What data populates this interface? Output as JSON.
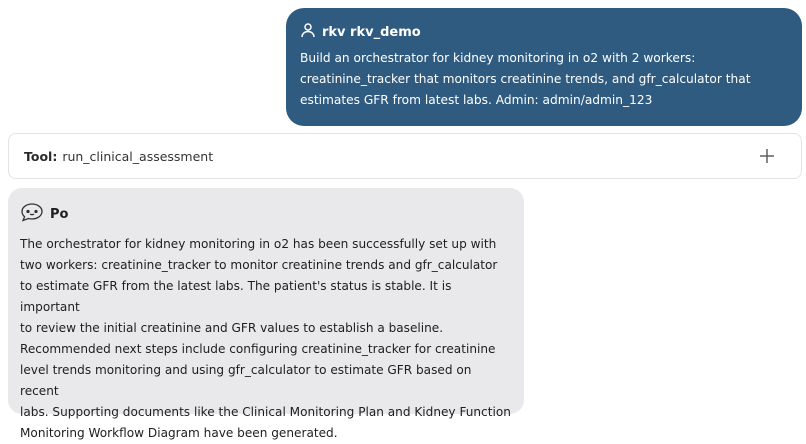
{
  "user_message": {
    "name": "rkv rkv_demo",
    "icon": "user-icon",
    "text": "Build an orchestrator for kidney monitoring in o2 with 2 workers:\ncreatinine_tracker that monitors creatinine trends, and gfr_calculator that\nestimates GFR from latest labs. Admin: admin/admin_123"
  },
  "tool": {
    "label": "Tool:",
    "name": "run_clinical_assessment",
    "expand_icon": "plus-icon"
  },
  "assistant_message": {
    "name": "Po",
    "icon": "chat-bubble-icon",
    "text": "The orchestrator for kidney monitoring in o2 has been successfully set up with\ntwo workers: creatinine_tracker to monitor creatinine trends and gfr_calculator\nto estimate GFR from the latest labs. The patient's status is stable. It is important\nto review the initial creatinine and GFR values to establish a baseline.\nRecommended next steps include configuring creatinine_tracker for creatinine\nlevel trends monitoring and using gfr_calculator to estimate GFR based on recent\nlabs. Supporting documents like the Clinical Monitoring Plan and Kidney Function\nMonitoring Workflow Diagram have been generated."
  },
  "colors": {
    "user_bubble": "#2f5b80",
    "assistant_bubble": "#e9e9eb"
  }
}
